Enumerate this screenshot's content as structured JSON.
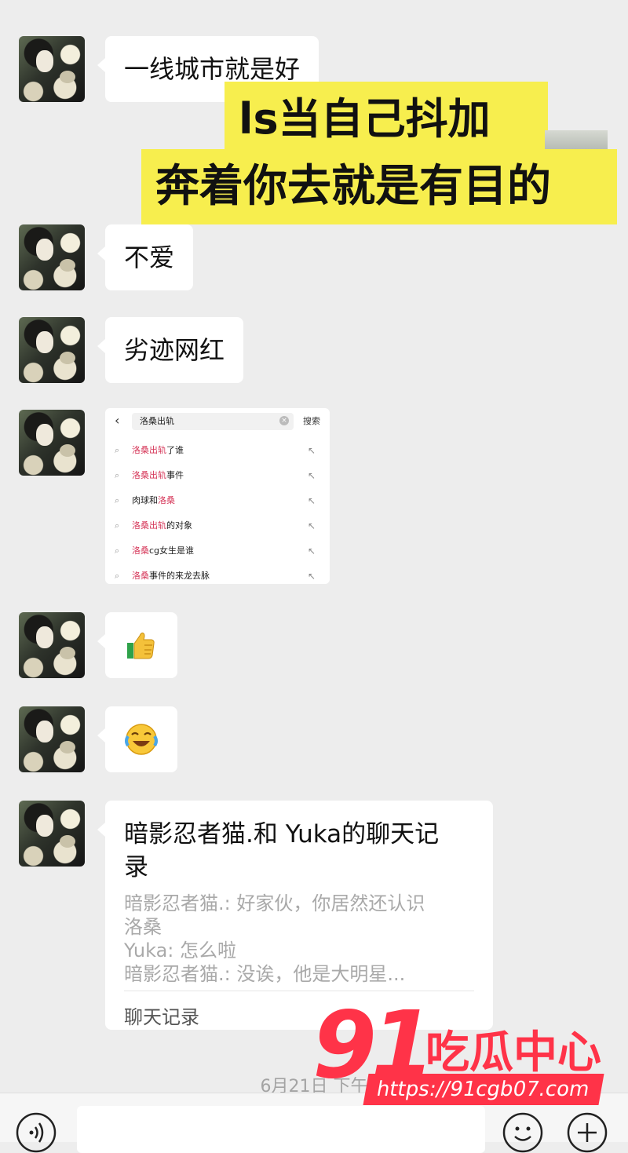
{
  "messages": [
    {
      "type": "text",
      "text": "一线城市就是好"
    },
    {
      "type": "text",
      "text": "不爱"
    },
    {
      "type": "text",
      "text": "劣迹网红"
    },
    {
      "type": "emoji",
      "icon": "thumbs-up-icon"
    },
    {
      "type": "emoji",
      "icon": "laughing-crying-face-icon"
    }
  ],
  "caption": {
    "line1": "ls当自己抖加",
    "line2": "奔着你去就是有目的",
    "color": "#f7ee4e"
  },
  "search_screenshot": {
    "query": "洛桑出轨",
    "search_label": "搜索",
    "suggestions": [
      {
        "hl": "洛桑出轨",
        "rest": "了谁"
      },
      {
        "hl": "洛桑出轨",
        "rest": "事件"
      },
      {
        "pre": "肉球和",
        "hl": "洛桑"
      },
      {
        "hl": "洛桑出轨",
        "rest": "的对象"
      },
      {
        "hl": "洛桑",
        "rest": "cg女生是谁"
      },
      {
        "hl": "洛桑",
        "rest": "事件的来龙去脉"
      }
    ],
    "highlight_color": "#d6385a"
  },
  "chat_record": {
    "title": "暗影忍者猫.和 Yuka的聊天记录",
    "lines": [
      "暗影忍者猫.: 好家伙，你居然还认识",
      "洛桑",
      "Yuka: 怎么啦",
      "暗影忍者猫.: 没诶，他是大明星..."
    ],
    "footer": "聊天记录"
  },
  "timestamp": "6月21日 下午",
  "watermark": {
    "number": "91",
    "name": "吃瓜中心",
    "url": "https://91cgb07.com",
    "color": "#ff3348"
  }
}
